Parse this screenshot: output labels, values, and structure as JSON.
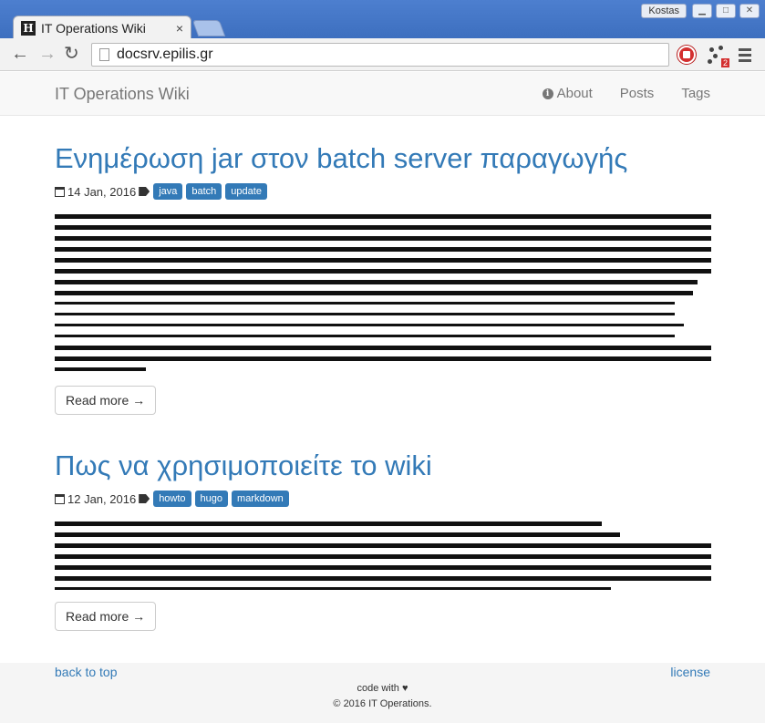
{
  "browser": {
    "tab_title": "IT Operations Wiki",
    "tab_favicon": "H",
    "tab_close": "×",
    "user_name": "Kostas",
    "url": "docsrv.epilis.gr",
    "ext_badge": "2"
  },
  "navbar": {
    "brand": "IT Operations Wiki",
    "links": [
      "About",
      "Posts",
      "Tags"
    ]
  },
  "posts": [
    {
      "title": "Ενημέρωση jar στον batch server παραγωγής",
      "date": "14 Jan, 2016",
      "tags": [
        "java",
        "batch",
        "update"
      ],
      "read_more": "Read more →"
    },
    {
      "title": "Πως να χρησιμοποιείτε το wiki",
      "date": "12 Jan, 2016",
      "tags": [
        "howto",
        "hugo",
        "markdown"
      ],
      "read_more": "Read more →"
    }
  ],
  "footer": {
    "back_to_top": "back to top",
    "license": "license",
    "code_with": "code with",
    "heart": "♥",
    "copyright": "© 2016 IT Operations."
  }
}
